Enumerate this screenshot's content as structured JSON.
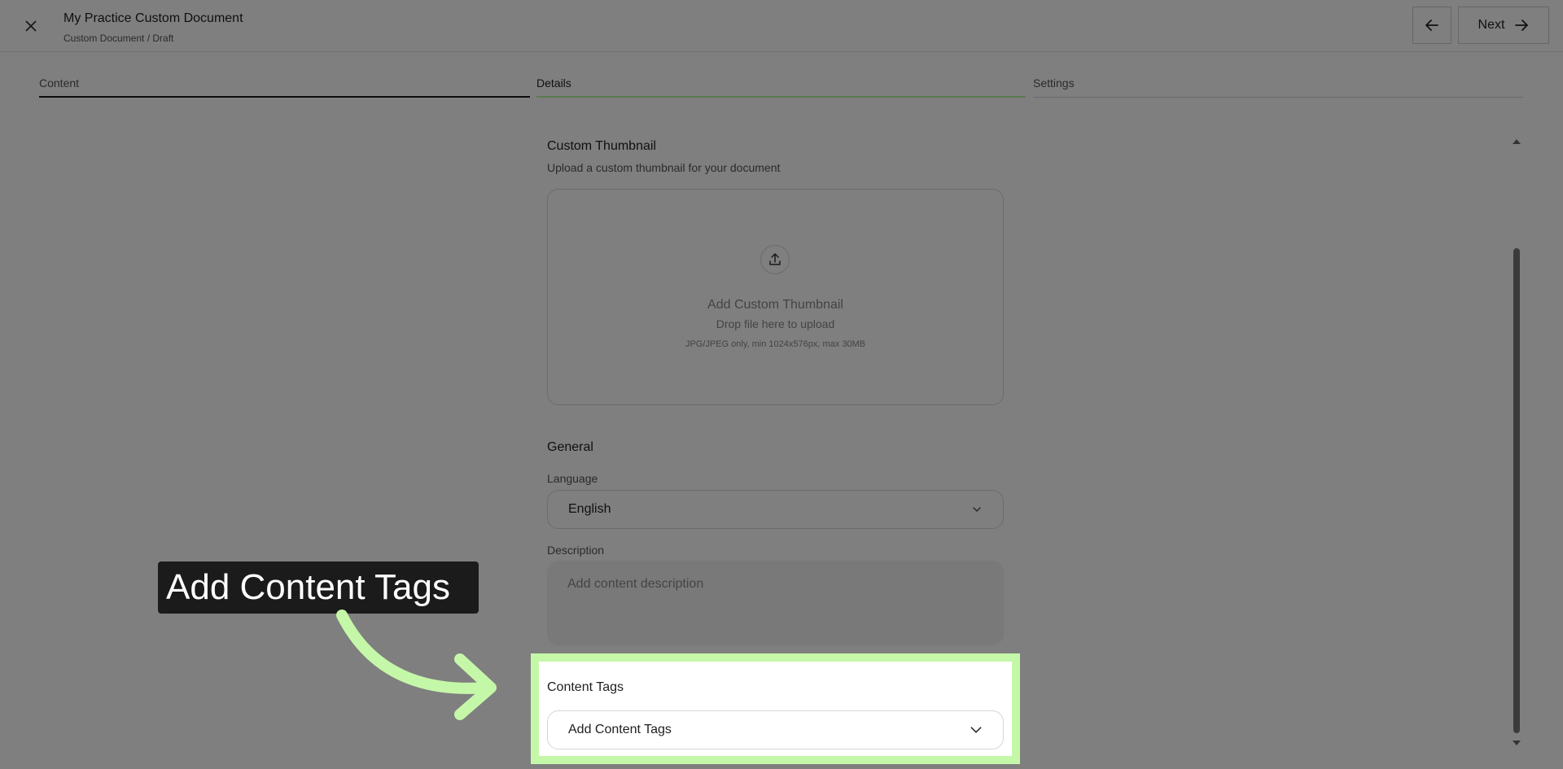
{
  "header": {
    "title": "My Practice Custom Document",
    "breadcrumb": "Custom Document / Draft",
    "next_label": "Next"
  },
  "tabs": [
    {
      "label": "Content",
      "state": "completed"
    },
    {
      "label": "Details",
      "state": "active"
    },
    {
      "label": "Settings",
      "state": "upcoming"
    }
  ],
  "thumbnail": {
    "title": "Custom Thumbnail",
    "subtitle": "Upload a custom thumbnail for your document",
    "upload_title": "Add Custom Thumbnail",
    "upload_hint": "Drop file here to upload",
    "upload_spec": "JPG/JPEG only, min 1024x576px, max 30MB"
  },
  "general": {
    "title": "General",
    "language_label": "Language",
    "language_value": "English",
    "description_label": "Description",
    "description_placeholder": "Add content description"
  },
  "content_tags": {
    "label": "Content Tags",
    "placeholder": "Add Content Tags"
  },
  "callout": {
    "text": "Add Content Tags"
  },
  "colors": {
    "accent": "#c5f7a8",
    "callout_bg": "#1b1b1b"
  },
  "icons": [
    "close-icon",
    "arrow-left-icon",
    "arrow-right-icon",
    "upload-icon",
    "chevron-down-icon"
  ]
}
